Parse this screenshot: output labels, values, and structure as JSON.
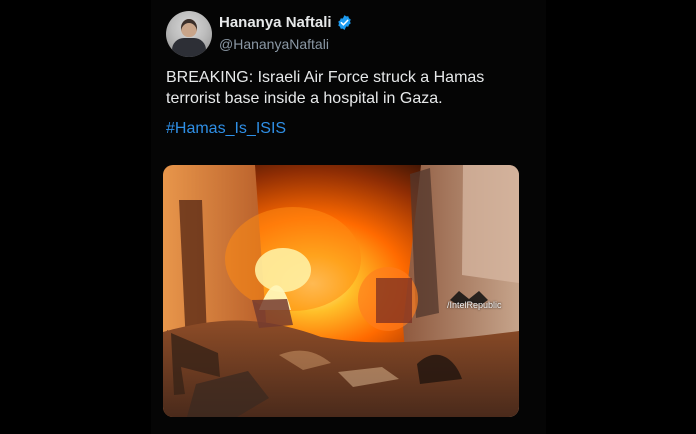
{
  "tweet": {
    "display_name": "Hananya Naftali",
    "handle": "@HananyaNaftali",
    "verified_icon": "verified-badge-icon",
    "text": "BREAKING: Israeli Air Force struck a Hamas terrorist base inside a hospital in Gaza.",
    "hashtag": "#Hamas_Is_ISIS",
    "media_watermark": "/IntelRepublic"
  },
  "colors": {
    "background": "#000000",
    "text": "#e7e9ea",
    "secondary_text": "#8b98a5",
    "link": "#2f8fe6",
    "verified": "#1d9bf0"
  }
}
